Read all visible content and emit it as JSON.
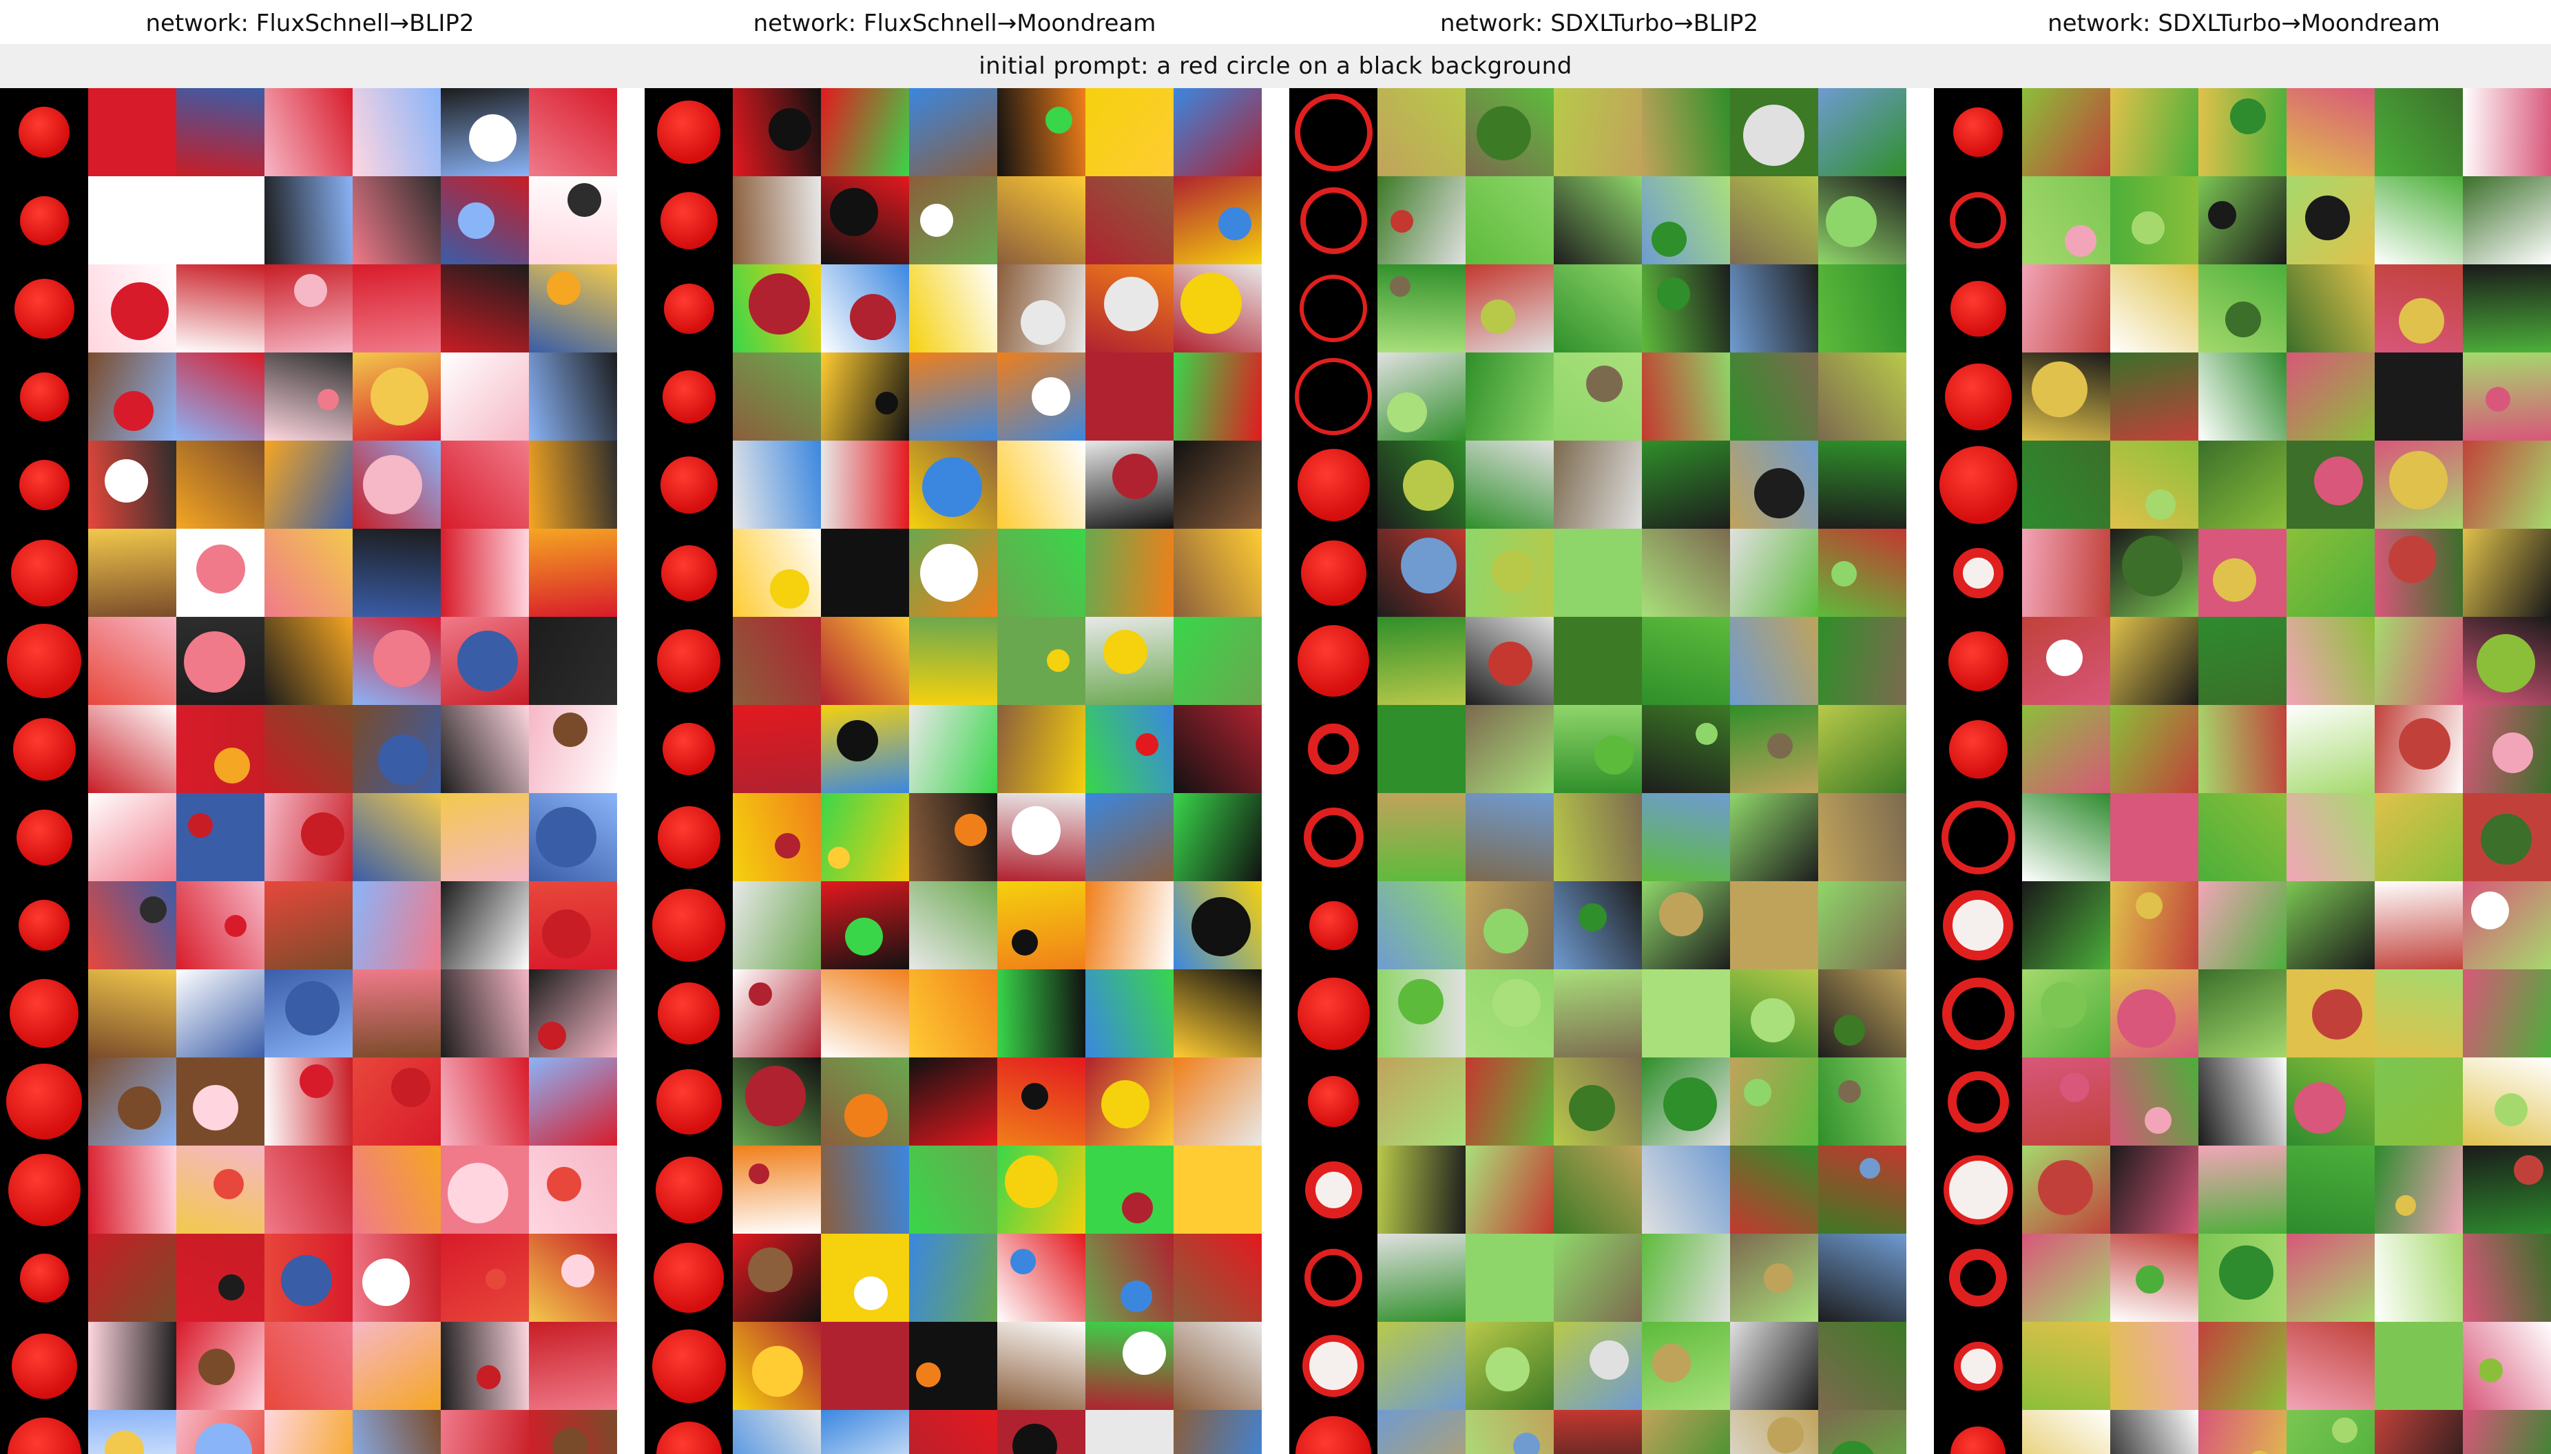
{
  "networks": [
    "network: FluxSchnell→BLIP2",
    "network: FluxSchnell→Moondream",
    "network: SDXLTurbo→BLIP2",
    "network: SDXLTurbo→Moondream"
  ],
  "initial_prompt": "initial prompt: a red circle on a black background",
  "grid": {
    "rows": 16,
    "cols": 7
  }
}
